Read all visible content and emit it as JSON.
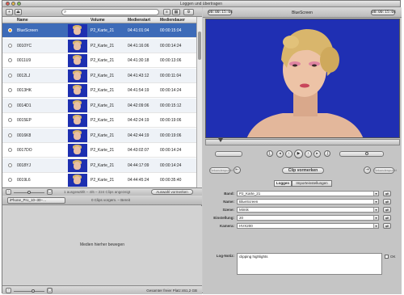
{
  "window": {
    "title": "Loggen und übertragen"
  },
  "left": {
    "columns": {
      "name": "Name",
      "volume": "Volume",
      "media_start": "Medienstart",
      "media_duration": "Mediendauer"
    },
    "rows": [
      {
        "name": "BlueScreen",
        "volume": "P2_Karte_21",
        "start": "04:41:01:04",
        "duration": "00:00:15:04",
        "selected": true
      },
      {
        "name": "0010YC",
        "volume": "P2_Karte_21",
        "start": "04:41:16:06",
        "duration": "00:00:14:24",
        "selected": false
      },
      {
        "name": "0011U9",
        "volume": "P2_Karte_21",
        "start": "04:41:30:18",
        "duration": "00:00:13:06",
        "selected": false
      },
      {
        "name": "0012LJ",
        "volume": "P2_Karte_21",
        "start": "04:41:43:12",
        "duration": "00:00:11:04",
        "selected": false
      },
      {
        "name": "0013HK",
        "volume": "P2_Karte_21",
        "start": "04:41:54:19",
        "duration": "00:00:14:24",
        "selected": false
      },
      {
        "name": "0014D1",
        "volume": "P2_Karte_21",
        "start": "04:42:09:06",
        "duration": "00:00:15:12",
        "selected": false
      },
      {
        "name": "0015EP",
        "volume": "P2_Karte_21",
        "start": "04:42:24:19",
        "duration": "00:00:19:06",
        "selected": false
      },
      {
        "name": "0016K8",
        "volume": "P2_Karte_21",
        "start": "04:42:44:19",
        "duration": "00:00:19:06",
        "selected": false
      },
      {
        "name": "0017DO",
        "volume": "P2_Karte_21",
        "start": "04:43:02:07",
        "duration": "00:00:14:24",
        "selected": false
      },
      {
        "name": "0018YJ",
        "volume": "P2_Karte_21",
        "start": "04:44:17:09",
        "duration": "00:00:14:24",
        "selected": false
      },
      {
        "name": "0019L6",
        "volume": "P2_Karte_21",
        "start": "04:44:45:24",
        "duration": "00:00:35:40",
        "selected": false
      }
    ],
    "info_text": "1 ausgewählt – 4/6 – 224 Clips angezeigt",
    "select_button": "Auswahl vormerken",
    "volume_select": "iPhone_Pro_10–30–…",
    "clips_status": "0 Clips vorgem. – Bereit",
    "drop_message": "Medien hierher bewegen",
    "free_space": "Gesamter freier Platz:461,2 GB"
  },
  "right": {
    "timecode_in": "00:00:15:04",
    "clip_name": "BlueScreen",
    "timecode_out": "00:00:15:04",
    "mark_button": "Clip vormerken",
    "in_label": "Sekundenpunkt",
    "out_label": "Sekundenpunkt",
    "tabs": [
      "Loggen",
      "Importeinstellungen"
    ],
    "fields": [
      {
        "label": "Band:",
        "value": "P2_Karte_21"
      },
      {
        "label": "Name:",
        "value": "BlueScreen"
      },
      {
        "label": "Szene:",
        "value": "Mimik"
      },
      {
        "label": "Einstellung:",
        "value": "20"
      },
      {
        "label": "Kamera:",
        "value": "HVX200"
      }
    ],
    "notes_label": "Log-Notiz:",
    "notes_value": "clipping highlights",
    "ok_label": "OK"
  },
  "colors": {
    "selection": "#3d6bb8",
    "bluescreen": "#1f2fb3"
  }
}
